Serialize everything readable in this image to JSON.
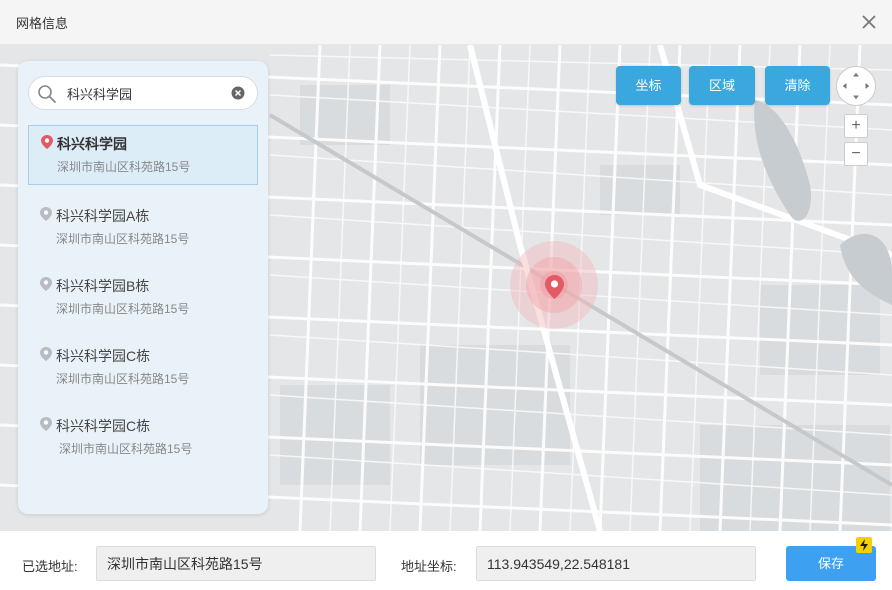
{
  "window": {
    "title": "网格信息"
  },
  "search": {
    "value": "科兴科学园"
  },
  "results": [
    {
      "name": "科兴科学园",
      "address": "深圳市南山区科苑路15号",
      "selected": true
    },
    {
      "name": "科兴科学园A栋",
      "address": "深圳市南山区科苑路15号",
      "selected": false
    },
    {
      "name": "科兴科学园B栋",
      "address": "深圳市南山区科苑路15号",
      "selected": false
    },
    {
      "name": "科兴科学园C栋",
      "address": "深圳市南山区科苑路15号",
      "selected": false
    },
    {
      "name": "科兴科学园C栋",
      "address": "深圳市南山区科苑路15号",
      "selected": false
    }
  ],
  "toolbar": {
    "coordinate_label": "坐标",
    "region_label": "区域",
    "clear_label": "清除"
  },
  "zoom": {
    "in_label": "+",
    "out_label": "−"
  },
  "footer": {
    "address_label": "已选地址:",
    "address_value": "深圳市南山区科苑路15号",
    "coords_label": "地址坐标:",
    "coords_value": "113.943549,22.548181",
    "save_label": "保存"
  },
  "colors": {
    "accent": "#3ba7df",
    "save": "#3ea0f0",
    "marker": "#e25a63",
    "panel": "#e9f2f8"
  },
  "icons": {
    "close": "close-icon",
    "search": "search-icon",
    "clear": "clear-icon",
    "pin": "location-pin-icon",
    "flash": "lightning-icon"
  }
}
